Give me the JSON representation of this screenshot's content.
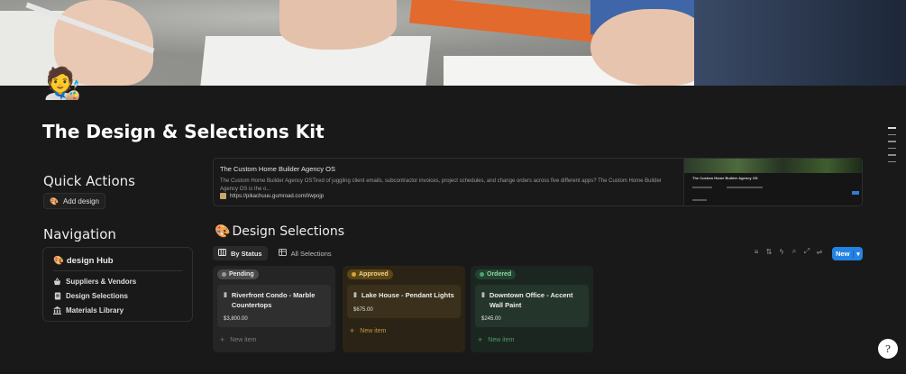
{
  "page": {
    "icon": "🧑‍🎨",
    "title": "The Design & Selections Kit"
  },
  "quick_actions": {
    "heading": "Quick Actions",
    "add_design_icon": "🎨",
    "add_design_label": "Add design"
  },
  "navigation": {
    "heading": "Navigation",
    "hub_icon": "🎨",
    "hub_label": "design Hub",
    "items": [
      {
        "icon": "basket-icon",
        "label": "Suppliers & Vendors"
      },
      {
        "icon": "document-icon",
        "label": "Design Selections"
      },
      {
        "icon": "library-icon",
        "label": "Materials Library"
      }
    ]
  },
  "bookmark": {
    "title": "The Custom Home Builder Agency OS",
    "description": "The Custom Home Builder Agency OSTired of juggling client emails, subcontractor invoices, project schedules, and change orders across five different apps? The Custom Home Builder Agency OS is the o...",
    "url": "https://pikachuuu.gumroad.com/l/wpojp",
    "thumb_title": "The Custom Home Builder Agency OS"
  },
  "database": {
    "icon": "🎨",
    "title": "Design Selections",
    "views": [
      {
        "label": "By Status",
        "active": true
      },
      {
        "label": "All Selections",
        "active": false
      }
    ],
    "new_label": "New",
    "columns": [
      {
        "status": "Pending",
        "colors": {
          "bg": "#252525",
          "tag_bg": "#4a4a4a",
          "tag_text": "#e6e6e6",
          "dot": "#9b9b9b",
          "card_bg": "#2f2f2f",
          "new_text": "#7a7a7a"
        },
        "card_title": "Riverfront Condo - Marble Countertops",
        "price": "$3,800.00",
        "new_item": "New item"
      },
      {
        "status": "Approved",
        "colors": {
          "bg": "#2b2416",
          "tag_bg": "#5c4614",
          "tag_text": "#f0d48a",
          "dot": "#d6a53a",
          "card_bg": "#3a301b",
          "new_text": "#c6963b"
        },
        "card_title": "Lake House - Pendant Lights",
        "price": "$675.00",
        "new_item": "New item"
      },
      {
        "status": "Ordered",
        "colors": {
          "bg": "#1b2620",
          "tag_bg": "#24432f",
          "tag_text": "#8fd3a6",
          "dot": "#4ea56b",
          "card_bg": "#24362b",
          "new_text": "#4f9b68"
        },
        "card_title": "Downtown Office - Accent Wall Paint",
        "price": "$245.00",
        "new_item": "New item"
      }
    ]
  },
  "accent_color": "#2383e2"
}
